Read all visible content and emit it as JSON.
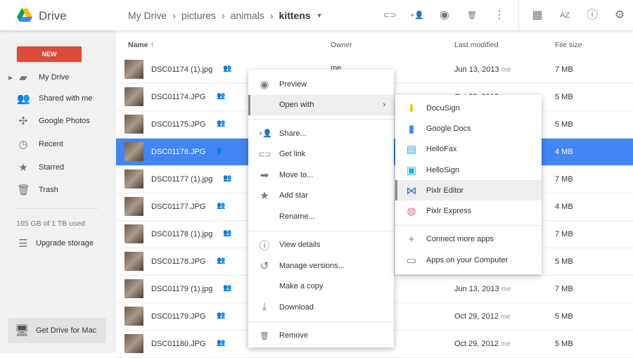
{
  "header": {
    "app_title": "Drive",
    "breadcrumb": [
      "My Drive",
      "pictures",
      "animals"
    ],
    "current_folder": "kittens",
    "tools": [
      {
        "icon": "link-icon",
        "glyph": "⊂⊃"
      },
      {
        "icon": "add-person-icon",
        "glyph": "+👤"
      },
      {
        "icon": "preview-eye-icon",
        "glyph": "◉"
      },
      {
        "icon": "trash-icon",
        "glyph": "🗑"
      },
      {
        "icon": "more-vert-icon",
        "glyph": "⋮"
      },
      {
        "icon": "grid-view-icon",
        "glyph": "▦"
      },
      {
        "icon": "sort-az-icon",
        "glyph": "AZ"
      },
      {
        "icon": "info-icon",
        "glyph": "ⓘ"
      },
      {
        "icon": "settings-gear-icon",
        "glyph": "⚙"
      }
    ]
  },
  "sidebar": {
    "new_label": "NEW",
    "items": [
      {
        "label": "My Drive",
        "icon": "my-drive-folder-icon",
        "glyph": "▰"
      },
      {
        "label": "Shared with me",
        "icon": "people-icon",
        "glyph": "👥"
      },
      {
        "label": "Google Photos",
        "icon": "pinwheel-icon",
        "glyph": "✣"
      },
      {
        "label": "Recent",
        "icon": "clock-icon",
        "glyph": "◷"
      },
      {
        "label": "Starred",
        "icon": "star-icon",
        "glyph": "★"
      },
      {
        "label": "Trash",
        "icon": "trash-icon",
        "glyph": "🗑"
      }
    ],
    "storage": "165 GB of 1 TB used",
    "upgrade": "Upgrade storage",
    "get_drive": "Get Drive for Mac"
  },
  "columns": {
    "name": "Name ↑",
    "owner": "Owner",
    "modified": "Last modified",
    "size": "File size"
  },
  "files": [
    {
      "name": "DSC01174 (1).jpg",
      "owner": "me",
      "date": "Jun 13, 2013",
      "by": "me",
      "size": "7 MB"
    },
    {
      "name": "DSC01174.JPG",
      "owner": "",
      "date": "Oct 29, 2012",
      "by": "me",
      "size": "5 MB"
    },
    {
      "name": "DSC01175.JPG",
      "owner": "",
      "date": "",
      "by": "",
      "size": "5 MB"
    },
    {
      "name": "DSC01176.JPG",
      "owner": "",
      "date": "",
      "by": "",
      "size": "4 MB",
      "selected": true
    },
    {
      "name": "DSC01177 (1).jpg",
      "owner": "",
      "date": "",
      "by": "",
      "size": "7 MB"
    },
    {
      "name": "DSC01177.JPG",
      "owner": "",
      "date": "",
      "by": "",
      "size": "4 MB"
    },
    {
      "name": "DSC01178 (1).jpg",
      "owner": "",
      "date": "",
      "by": "",
      "size": "7 MB"
    },
    {
      "name": "DSC01178.JPG",
      "owner": "",
      "date": "",
      "by": "",
      "size": "5 MB"
    },
    {
      "name": "DSC01179 (1).jpg",
      "owner": "",
      "date": "Jun 13, 2013",
      "by": "me",
      "size": "7 MB"
    },
    {
      "name": "DSC01179.JPG",
      "owner": "",
      "date": "Oct 29, 2012",
      "by": "me",
      "size": "5 MB"
    },
    {
      "name": "DSC01180.JPG",
      "owner": "",
      "date": "Oct 29, 2012",
      "by": "me",
      "size": "5 MB"
    }
  ],
  "context_menu": [
    {
      "label": "Preview",
      "icon": "eye-icon",
      "glyph": "◉"
    },
    {
      "label": "Open with",
      "icon": "",
      "glyph": "",
      "submenu": true,
      "highlighted": true
    },
    {
      "divider": true
    },
    {
      "label": "Share...",
      "icon": "add-person-icon",
      "glyph": "+👤"
    },
    {
      "label": "Get link",
      "icon": "link-icon",
      "glyph": "⊂⊃"
    },
    {
      "label": "Move to...",
      "icon": "move-folder-icon",
      "glyph": "➡"
    },
    {
      "label": "Add star",
      "icon": "star-icon",
      "glyph": "★"
    },
    {
      "label": "Rename...",
      "icon": "",
      "glyph": ""
    },
    {
      "divider": true
    },
    {
      "label": "View details",
      "icon": "info-icon",
      "glyph": "ⓘ"
    },
    {
      "label": "Manage versions...",
      "icon": "history-icon",
      "glyph": "↺"
    },
    {
      "label": "Make a copy",
      "icon": "",
      "glyph": ""
    },
    {
      "label": "Download",
      "icon": "download-icon",
      "glyph": "⤓"
    },
    {
      "divider": true
    },
    {
      "label": "Remove",
      "icon": "trash-icon",
      "glyph": "🗑"
    }
  ],
  "open_with_menu": [
    {
      "label": "DocuSign",
      "icon": "docusign-icon",
      "glyph": "⬇",
      "color": "#f4c20d"
    },
    {
      "label": "Google Docs",
      "icon": "google-docs-icon",
      "glyph": "▮",
      "color": "#4285f4"
    },
    {
      "label": "HelloFax",
      "icon": "hellofax-icon",
      "glyph": "▤",
      "color": "#2aa7df"
    },
    {
      "label": "HelloSign",
      "icon": "hellosign-icon",
      "glyph": "▣",
      "color": "#1fb5e0"
    },
    {
      "label": "Pixlr Editor",
      "icon": "pixlr-editor-icon",
      "glyph": "⋈",
      "color": "#3b6fb6",
      "highlighted": true
    },
    {
      "label": "Pixlr Express",
      "icon": "pixlr-express-icon",
      "glyph": "◍",
      "color": "#d96aa0"
    },
    {
      "divider": true
    },
    {
      "label": "Connect more apps",
      "icon": "plus-icon",
      "glyph": "+",
      "color": "#777"
    },
    {
      "label": "Apps on your Computer",
      "icon": "laptop-icon",
      "glyph": "▭",
      "color": "#777"
    }
  ],
  "colors": {
    "new_button": "#dd4b39",
    "selection": "#4285f4"
  }
}
